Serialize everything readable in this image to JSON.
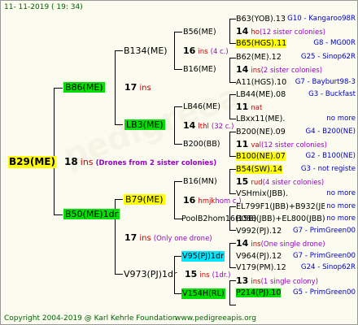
{
  "header": {
    "date": "11- 11-2019 ( 19: 34)"
  },
  "footer": {
    "copyright": "Copyright 2004-2019 @ Karl Kehrle Foundation",
    "url": "www.pedigreeapis.org"
  },
  "root": {
    "name": "B29(ME)",
    "num": "18",
    "ins": "ins",
    "note": "(Drones from 2 sister colonies)"
  },
  "g1": [
    {
      "name": "B86(ME)"
    },
    {
      "name": "B50(ME)1dr",
      "num": "17",
      "ins": "ins",
      "note": "(Only one drone)"
    }
  ],
  "g2": [
    {
      "name": "B134(ME)",
      "num": "17",
      "ins": "ins"
    },
    {
      "name": "LB3(ME)"
    },
    {
      "name": "B79(ME)",
      "num": "17",
      "ins": "ins"
    },
    {
      "name": "V973(PJ)1dr",
      "num": "15",
      "ins": "ins",
      "note": "(1dr.)"
    }
  ],
  "g3": [
    {
      "name": "B56(ME)",
      "num": "16",
      "ins": "ins",
      "note": "(4 c.)"
    },
    {
      "name": "B16(ME)"
    },
    {
      "name": "LB46(ME)",
      "num": "14",
      "ins": "lthl",
      "note": "(32 c.)"
    },
    {
      "name": "B200(BB)"
    },
    {
      "name": "B16(MN)",
      "num": "16",
      "ins": "hmjk",
      "note": "hom c.)"
    },
    {
      "name": "PoolB2hom16(15B)"
    },
    {
      "name": "V95(PJ)1dr",
      "num": "15",
      "ins": "ins",
      "note": "(1dr.)"
    },
    {
      "name": "V154H(RL)"
    }
  ],
  "g4": [
    {
      "name": "B63(YOB).13",
      "right": "G10 - Kangaroo98R"
    },
    {
      "num": "14",
      "ins": "ho",
      "note": "(12 sister colonies)"
    },
    {
      "name": "B65(HGS).11",
      "right": "G8 - MG00R"
    },
    {
      "name": "B62(ME).12",
      "right": "G25 - Sinop62R"
    },
    {
      "num": "14",
      "ins": "ins",
      "note": "(2 sister colonies)"
    },
    {
      "name": "A11(HGS).10",
      "right": "G7 - Bayburt98-3"
    },
    {
      "name": "LB44(ME).08",
      "right": "G3 - Buckfast"
    },
    {
      "num": "11",
      "ins": "nat"
    },
    {
      "name": "LBxx11(ME).",
      "right": "no more"
    },
    {
      "name": "B200(NE).09",
      "right": "G4 - B200(NE)"
    },
    {
      "num": "11",
      "ins": "val",
      "note": "(12 sister colonies)"
    },
    {
      "name": "B100(NE).07",
      "right": "G2 - B100(NE)"
    },
    {
      "name": "B54(SW).14",
      "right": "G3 - not registe"
    },
    {
      "num": "15",
      "ins": "rud",
      "note": "(4 sister colonies)"
    },
    {
      "name": "VSHmix(JBB).",
      "right": "no more"
    },
    {
      "name": "EL799F1(JBB)+B932(JBB)+B72",
      "right": "no more"
    },
    {
      "name": "B088(JBB)+EL800(JBB)",
      "right": "no more"
    },
    {
      "name": "V992(PJ).12",
      "right": "G7 - PrimGreen00"
    },
    {
      "num": "14",
      "ins": "ins",
      "note": "(One single drone)"
    },
    {
      "name": "V964(PJ).12",
      "right": "G7 - PrimGreen00"
    },
    {
      "name": "V179(PM).12",
      "right": "G24 - Sinop62R"
    },
    {
      "num": "13",
      "ins": "ins",
      "note": "(1 single colony)"
    },
    {
      "name": "P214(PJ).10",
      "right": "G5 - PrimGreen00"
    }
  ],
  "colors": {
    "green": "#00e000",
    "yellow": "#ffff00",
    "cyan": "#00e8ff",
    "red": "#cc0000",
    "blue": "#0000cc",
    "footer_green": "#006400",
    "purple": "#9900cc"
  },
  "watermark": "pedigreeapis"
}
